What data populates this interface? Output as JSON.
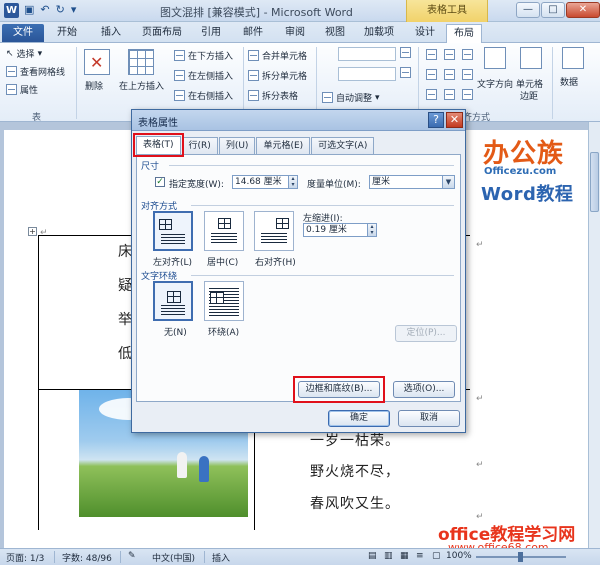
{
  "window": {
    "title": "图文混排 [兼容模式] - Microsoft Word",
    "app_icon": "W",
    "context_group": "表格工具",
    "controls": [
      "—",
      "□",
      "✕"
    ]
  },
  "ribbon_tabs": [
    "文件",
    "开始",
    "插入",
    "页面布局",
    "引用",
    "邮件",
    "审阅",
    "视图",
    "加载项",
    "设计",
    "布局"
  ],
  "ribbon": {
    "select": "选择",
    "view_gridlines": "查看网格线",
    "properties": "属性",
    "table_group": "表",
    "delete": "删除",
    "insert_above": "在上方插入",
    "insert_below": "在下方插入",
    "insert_left": "在左侧插入",
    "insert_right": "在右侧插入",
    "merge_cells": "合并单元格",
    "split_cells": "拆分单元格",
    "split_table": "拆分表格",
    "autofit": "自动调整",
    "alignment_group": "对齐方式",
    "text_direction": "文字方向",
    "cell_margins_1": "单元格",
    "cell_margins_2": "边距",
    "data": "数据"
  },
  "document": {
    "cells_left": [
      "床",
      "疑",
      "举",
      "低"
    ],
    "poem_lines": [
      "一岁一枯荣。",
      "野火烧不尽，",
      "春风吹又生。"
    ]
  },
  "logo": {
    "main": "办公族",
    "site": "Officezu.com",
    "product": "Word教程"
  },
  "watermark": {
    "line1": "office教程学习网",
    "line2": "www.office68.com"
  },
  "statusbar": {
    "page": "页面: 1/3",
    "words": "字数: 48/96",
    "language": "中文(中国)",
    "mode": "插入",
    "zoom": "100%"
  },
  "dialog": {
    "title": "表格属性",
    "help": "?",
    "close": "✕",
    "tabs": [
      "表格(T)",
      "行(R)",
      "列(U)",
      "单元格(E)",
      "可选文字(A)"
    ],
    "size_section": "尺寸",
    "preferred_width_label": "指定宽度(W):",
    "preferred_width_checked": true,
    "preferred_width_value": "14.68 厘米",
    "measure_label": "度量单位(M):",
    "measure_value": "厘米",
    "alignment_section": "对齐方式",
    "align_left": "左对齐(L)",
    "align_center": "居中(C)",
    "align_right": "右对齐(H)",
    "indent_label": "左缩进(I):",
    "indent_value": "0.19 厘米",
    "wrapping_section": "文字环绕",
    "wrap_none": "无(N)",
    "wrap_around": "环绕(A)",
    "positioning_button": "定位(P)...",
    "borders_button": "边框和底纹(B)...",
    "options_button": "选项(O)...",
    "ok_button": "确定",
    "cancel_button": "取消"
  },
  "colors": {
    "highlight": "#e0101a",
    "accent": "#2b579a"
  }
}
